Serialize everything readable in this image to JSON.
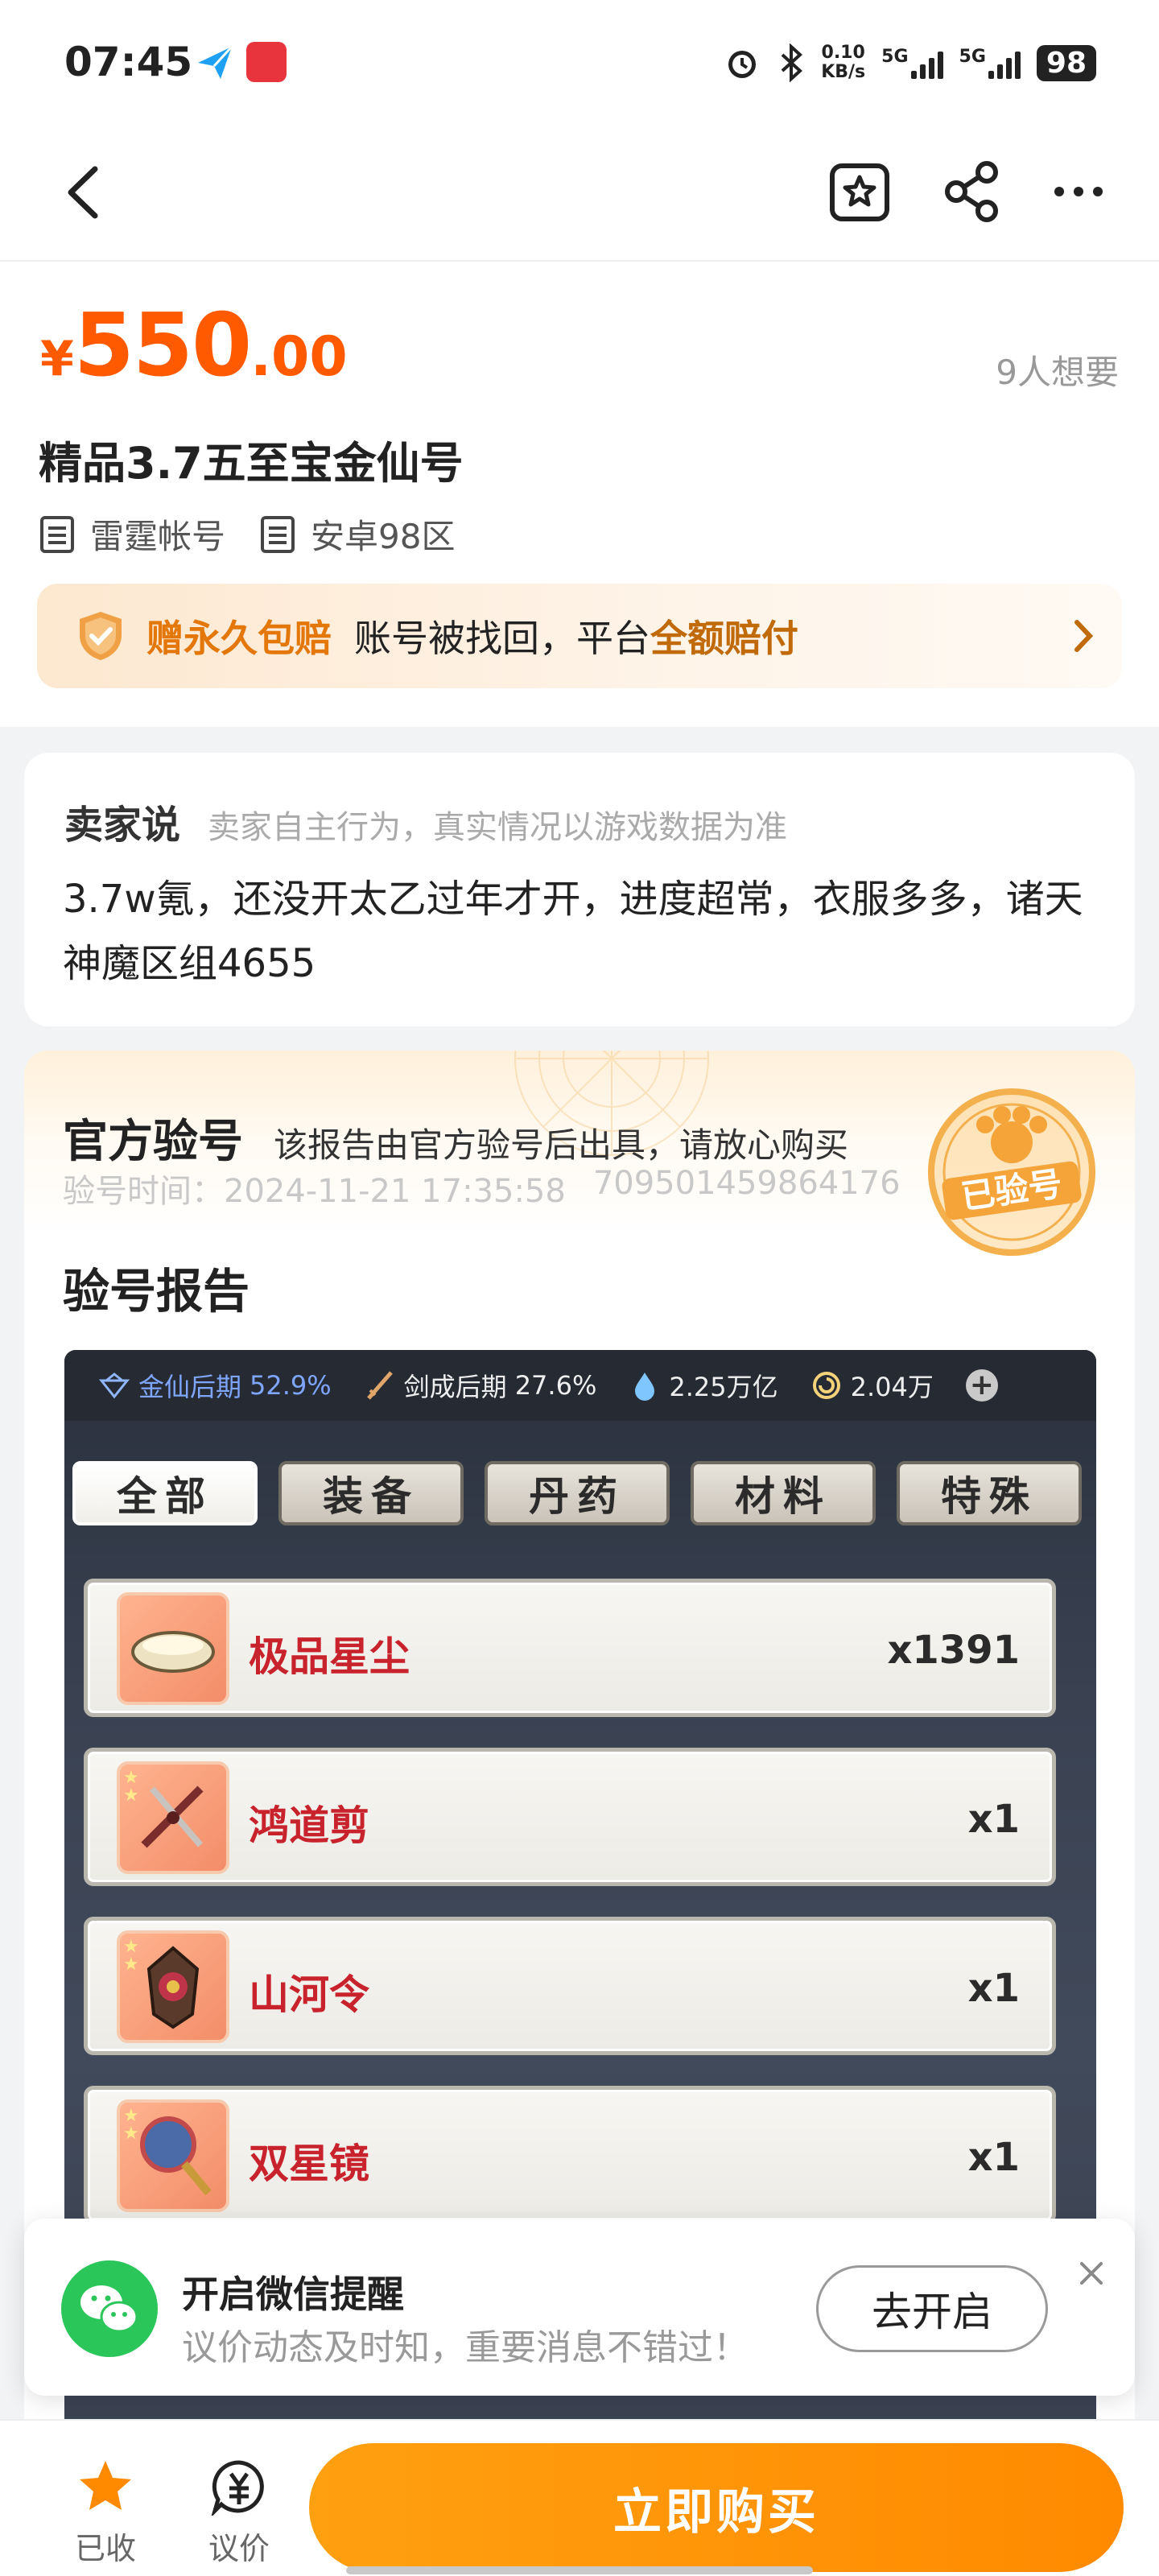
{
  "status_bar": {
    "time": "07:45",
    "net_speed_value": "0.10",
    "net_speed_unit": "KB/s",
    "signal1": "5G",
    "signal2": "5G",
    "battery": "98"
  },
  "product": {
    "currency": "¥",
    "price_int": "550",
    "price_dec": ".00",
    "want_count": "9人想要",
    "title": "精品3.7五至宝金仙号",
    "tags": [
      "雷霆帐号",
      "安卓98区"
    ],
    "guarantee": {
      "badge": "赠永久包赔",
      "text": "账号被找回，平台",
      "highlight": "全额赔付"
    }
  },
  "seller": {
    "label": "卖家说",
    "note": "卖家自主行为，真实情况以游戏数据为准",
    "body": "3.7w氪，还没开太乙过年才开，进度超常，衣服多多，诸天神魔区组4655"
  },
  "official": {
    "title": "官方验号",
    "note": "该报告由官方验号后出具，请放心购买",
    "time_label": "验号时间：2024-11-21 17:35:58",
    "report_id": "709501459864176",
    "stamp_text": "已验号",
    "report_title": "验号报告"
  },
  "game": {
    "stats": [
      {
        "label": "金仙后期",
        "value": "52.9%"
      },
      {
        "label": "剑成后期",
        "value": "27.6%"
      },
      {
        "label": "",
        "value": "2.25万亿"
      },
      {
        "label": "",
        "value": "2.04万"
      }
    ],
    "tabs": [
      "全部",
      "装备",
      "丹药",
      "材料",
      "特殊"
    ],
    "items": [
      {
        "name": "极品星尘",
        "qty": "x1391"
      },
      {
        "name": "鸿道剪",
        "qty": "x1"
      },
      {
        "name": "山河令",
        "qty": "x1"
      },
      {
        "name": "双星镜",
        "qty": "x1"
      }
    ]
  },
  "popup": {
    "title": "开启微信提醒",
    "subtitle": "议价动态及时知，重要消息不错过！",
    "button": "去开启"
  },
  "bottom": {
    "fav_label": "已收藏",
    "bargain_label": "议价",
    "buy_label": "立即购买"
  },
  "colors": {
    "accent": "#ff8a00",
    "price": "#ff5a00",
    "wechat": "#2bc65a"
  }
}
